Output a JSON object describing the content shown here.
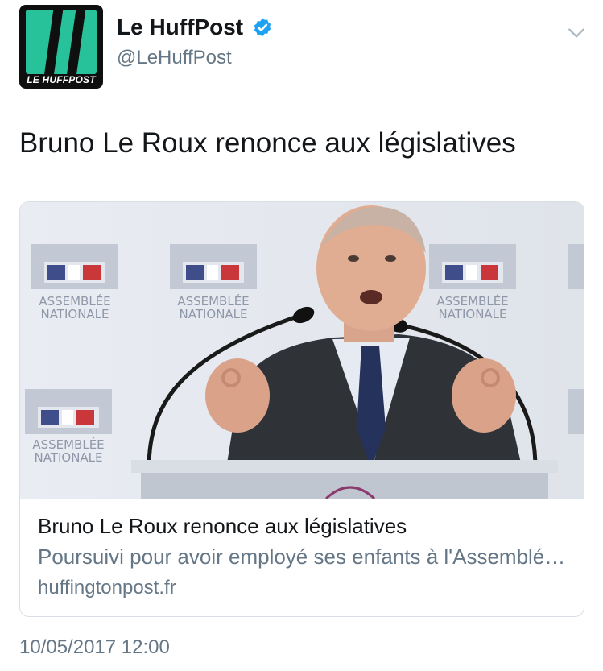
{
  "author": {
    "display_name": "Le HuffPost",
    "handle": "@LeHuffPost",
    "avatar_text": "LE HUFFPOST",
    "verified": true
  },
  "tweet": {
    "text": "Bruno Le Roux renonce aux législatives",
    "timestamp": "10/05/2017 12:00"
  },
  "card": {
    "title": "Bruno Le Roux renonce aux législatives",
    "description": "Poursuivi pour avoir employé ses enfants à l'Assemblée...",
    "domain": "huffingtonpost.fr",
    "backdrop_logo_line1": "ASSEMBLÉE",
    "backdrop_logo_line2": "NATIONALE"
  },
  "icons": {
    "verified": "verified-badge-icon",
    "menu": "chevron-down-icon"
  },
  "colors": {
    "brand_green": "#27c29a",
    "verified_blue": "#1da1f2",
    "text_primary": "#14171a",
    "text_secondary": "#657786",
    "border": "#d8dee3"
  }
}
